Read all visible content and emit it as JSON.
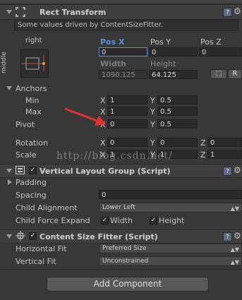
{
  "rect_transform": {
    "title": "Rect Transform",
    "notice": "Some values driven by ContentSizeFitter.",
    "anchor_preset_top": "right",
    "anchor_preset_side": "middle",
    "pos_x_label": "Pos X",
    "pos_y_label": "Pos Y",
    "pos_z_label": "Pos Z",
    "pos_x": "0",
    "pos_y": "0",
    "pos_z": "0",
    "width_label": "Width",
    "height_label": "Height",
    "width": "1090.125",
    "height": "64.125",
    "blueprint_button": "⬚",
    "raw_button": "R",
    "anchors_label": "Anchors",
    "min_label": "Min",
    "max_label": "Max",
    "x_axis": "X",
    "y_axis": "Y",
    "z_axis": "Z",
    "anchor_min_x": "1",
    "anchor_min_y": "0.5",
    "anchor_max_x": "1",
    "anchor_max_y": "0.5",
    "pivot_label": "Pivot",
    "pivot_x": "0",
    "pivot_y": "0.5",
    "rotation_label": "Rotation",
    "rotation_x": "0",
    "rotation_y": "0",
    "rotation_z": "0",
    "scale_label": "Scale",
    "scale_x": "1",
    "scale_y": "1",
    "scale_z": "1"
  },
  "vertical_layout": {
    "title": "Vertical Layout Group (Script)",
    "padding_label": "Padding",
    "spacing_label": "Spacing",
    "spacing": "0",
    "child_alignment_label": "Child Alignment",
    "child_alignment": "Lower Left",
    "child_force_expand_label": "Child Force Expand",
    "width_label": "Width",
    "height_label": "Height"
  },
  "content_size_fitter": {
    "title": "Content Size Fitter (Script)",
    "horizontal_fit_label": "Horizontal Fit",
    "horizontal_fit": "Preferred Size",
    "vertical_fit_label": "Vertical Fit",
    "vertical_fit": "Unconstrained"
  },
  "add_component_label": "Add Component",
  "watermark": "http://blog.csdn.net/",
  "colors": {
    "background": "#383838",
    "header": "#3f3f3f",
    "accent_blue": "#5a8fe8",
    "annotation_red": "#e53030"
  }
}
